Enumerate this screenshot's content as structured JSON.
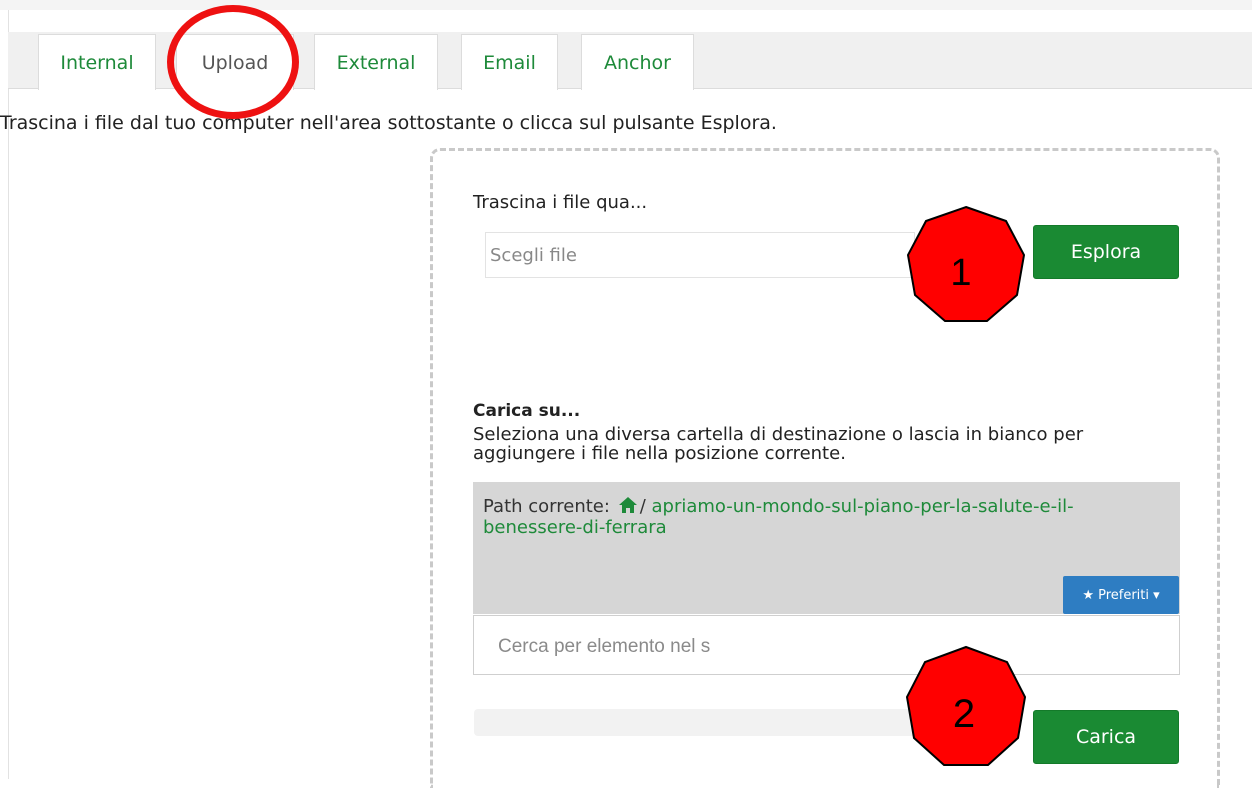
{
  "tabs": [
    {
      "label": "Internal",
      "active": false
    },
    {
      "label": "Upload",
      "active": true
    },
    {
      "label": "External",
      "active": false
    },
    {
      "label": "Email",
      "active": false
    },
    {
      "label": "Anchor",
      "active": false
    }
  ],
  "intro_text": "Trascina i file dal tuo computer nell'area sottostante o clicca sul pulsante Esplora.",
  "dropzone": {
    "drag_label": "Trascina i file qua...",
    "file_placeholder": "Scegli file",
    "browse_button": "Esplora"
  },
  "upload_to": {
    "title": "Carica su...",
    "description": "Seleziona una diversa cartella di destinazione o lascia in bianco per aggiungere i file nella posizione corrente.",
    "path_label": "Path corrente:",
    "path_separator": "/",
    "path_link": "apriamo-un-mondo-sul-piano-per-la-salute-e-il-benessere-di-ferrara",
    "favorites_button": "★ Preferiti ▾",
    "search_placeholder": "Cerca per elemento nel s"
  },
  "upload_button": "Carica",
  "annotations": {
    "step1": "1",
    "step2": "2"
  },
  "colors": {
    "accent_green": "#1a8a33",
    "link_green": "#1e8a3a",
    "favorites_blue": "#2e7dc2",
    "annotation_red": "#ee1111"
  },
  "icons": [
    "home-icon",
    "star-icon",
    "caret-down-icon"
  ]
}
